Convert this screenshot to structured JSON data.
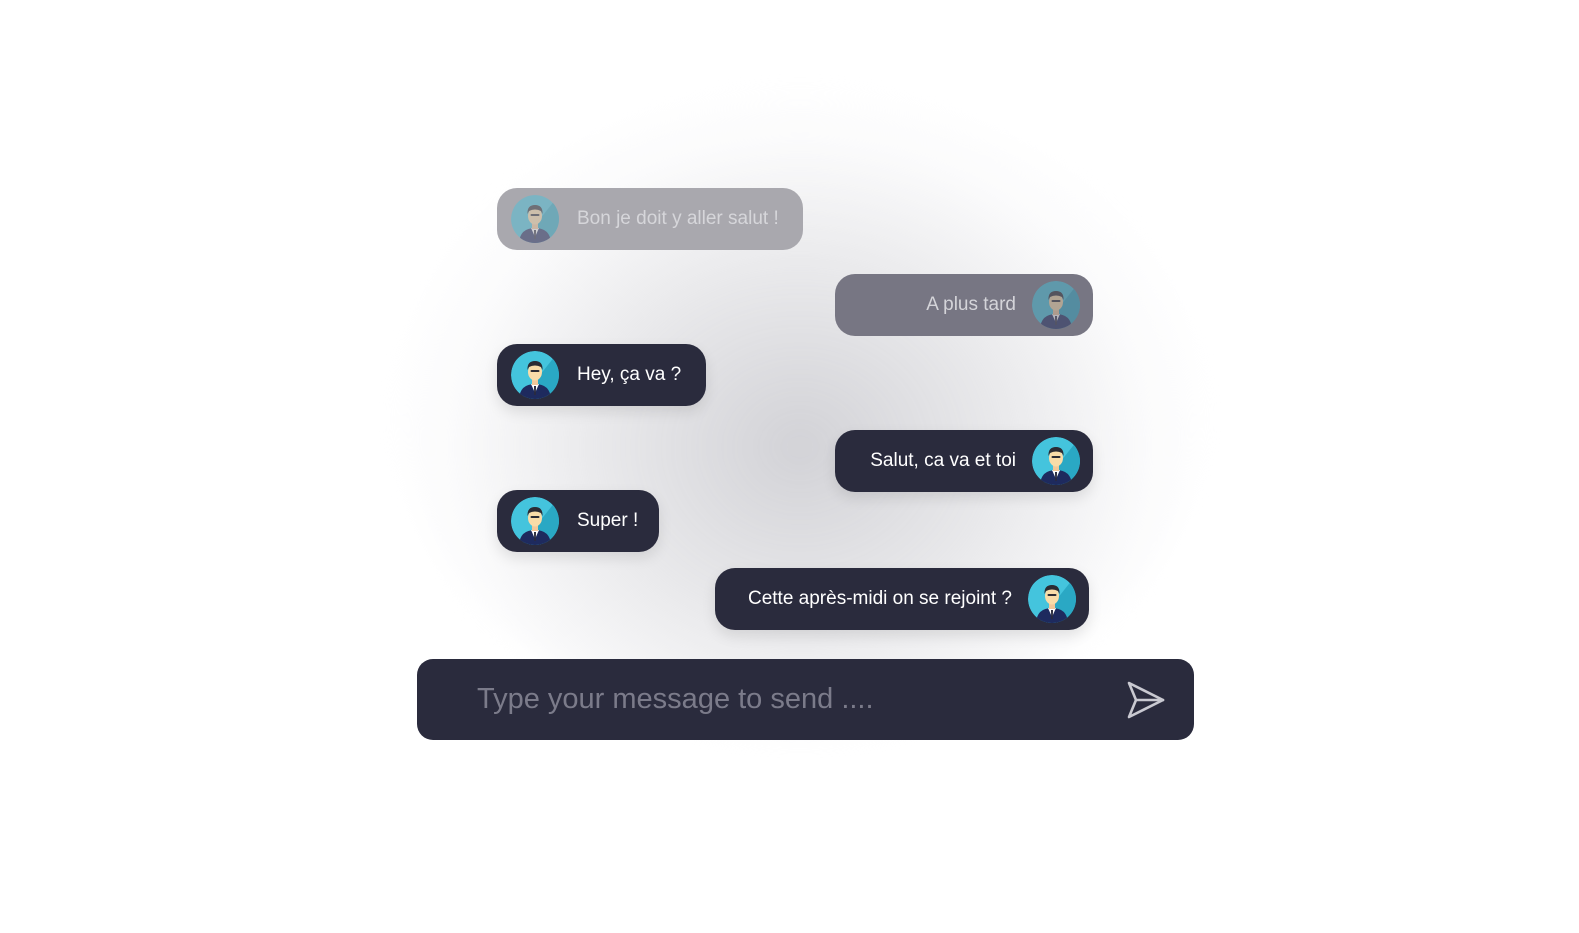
{
  "messages": [
    {
      "text": "Bon je doit y aller salut !",
      "side": "left",
      "state": "faded"
    },
    {
      "text": "A plus tard",
      "side": "right",
      "state": "faded"
    },
    {
      "text": "Hey, ça va ?",
      "side": "left",
      "state": "active"
    },
    {
      "text": "Salut, ca va et toi",
      "side": "right",
      "state": "active"
    },
    {
      "text": "Super !",
      "side": "left",
      "state": "active"
    },
    {
      "text": "Cette après-midi on se rejoint ?",
      "side": "right",
      "state": "active"
    }
  ],
  "composer": {
    "placeholder": "Type your message to send ....",
    "send_icon": "send-icon"
  },
  "colors": {
    "bubble": "#2a2b3d",
    "bubble_faded": "#a9a8ae",
    "text": "#ffffff",
    "placeholder": "#7b7b8a",
    "avatar_bg": "#44c4dd"
  }
}
